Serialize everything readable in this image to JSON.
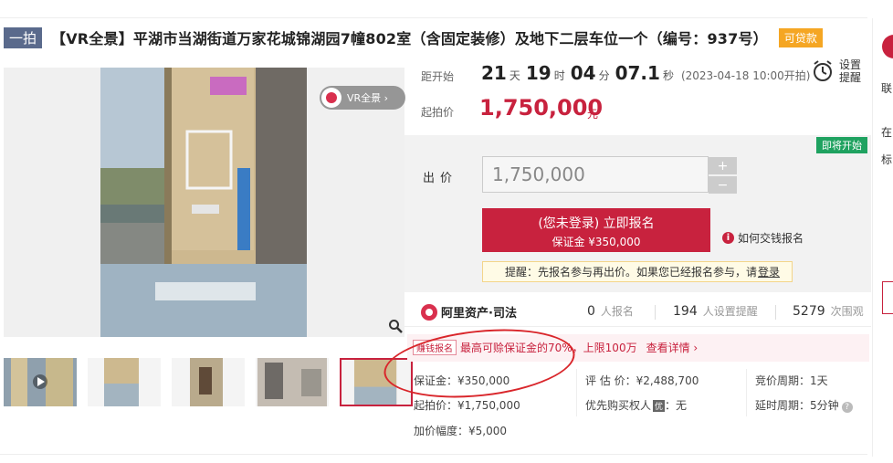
{
  "listing": {
    "type_tag": "一拍",
    "title": "【VR全景】平湖市当湖街道万家花城锦湖园7幢802室（含固定装修）及地下二层车位一个（编号：937号）",
    "loan_badge": "可贷款"
  },
  "gallery": {
    "vr_label": "VR全景 ›",
    "thumbnail_count": 5,
    "active_index": 4
  },
  "countdown": {
    "label": "距开始",
    "days": "21",
    "days_unit": "天",
    "hours": "19",
    "hours_unit": "时",
    "minutes": "04",
    "minutes_unit": "分",
    "seconds": "07.1",
    "seconds_unit": "秒",
    "start_time": "(2023-04-18 10:00开拍)"
  },
  "reminder": {
    "label": "设置提醒"
  },
  "starting_price": {
    "label": "起拍价",
    "value": "1,750,000",
    "unit": "元"
  },
  "bid": {
    "status_badge": "即将开始",
    "label": "出价",
    "input_value": "1,750,000",
    "plus": "+",
    "minus": "−",
    "signup_line1": "(您未登录) 立即报名",
    "signup_line2": "保证金 ¥350,000",
    "how_to": "如何交钱报名",
    "tip_prefix": "提醒：先报名参与再出价。如果您已经报名参与，请",
    "tip_login": "登录"
  },
  "stats": {
    "brand": "阿里资产·司法",
    "signups": "0",
    "signups_label": "人报名",
    "reminders": "194",
    "reminders_label": "人设置提醒",
    "views": "5279",
    "views_label": "次围观"
  },
  "promo": {
    "tag": "赚钱报名",
    "text": "最高可赊保证金的70%，上限100万",
    "link": "查看详情 ›"
  },
  "details": {
    "deposit": "保证金：¥350,000",
    "appraisal": "评 估 价：¥2,488,700",
    "cycle": "竞价周期：1天",
    "start_price": "起拍价：¥1,750,000",
    "priority_label": "优先购买权人",
    "priority_badge": "优",
    "priority_value": "：无",
    "delay": "延时周期：5分钟",
    "increment": "加价幅度：¥5,000"
  },
  "side": {
    "t1": "联",
    "t2": "在",
    "t3": "标"
  },
  "colors": {
    "accent_red": "#c8223e",
    "tag_blue_gray": "#5a6a8c",
    "loan_orange": "#f5a623",
    "soon_green": "#1fa260"
  }
}
